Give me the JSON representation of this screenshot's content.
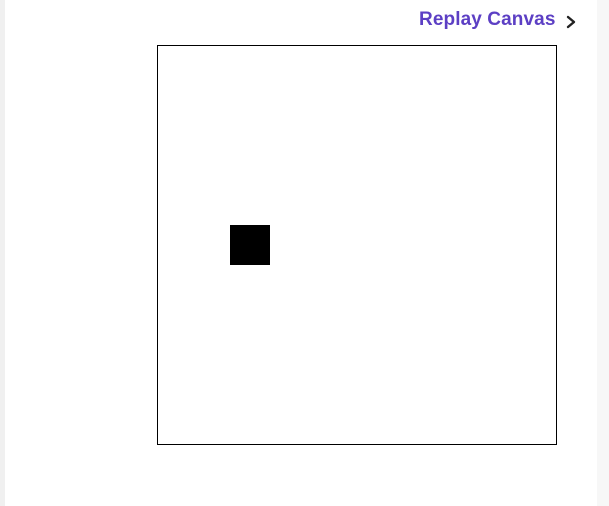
{
  "replay": {
    "label": "Replay Canvas",
    "color": "#5c3fc4"
  },
  "canvas": {
    "border_color": "#000000",
    "shape_color": "#000000"
  },
  "icons": {
    "replay_chevron": "chevron-right-icon"
  }
}
